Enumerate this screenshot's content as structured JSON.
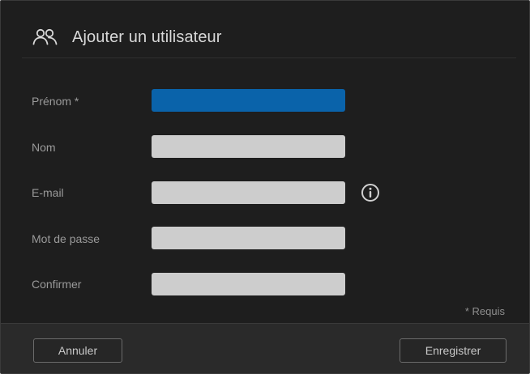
{
  "dialog": {
    "title": "Ajouter un utilisateur",
    "title_icon": "users-icon"
  },
  "form": {
    "fields": [
      {
        "label": "Prénom *",
        "value": "",
        "focused": true
      },
      {
        "label": "Nom",
        "value": ""
      },
      {
        "label": "E-mail",
        "value": "",
        "help_icon": "info-icon"
      },
      {
        "label": "Mot de passe",
        "value": ""
      },
      {
        "label": "Confirmer",
        "value": ""
      }
    ],
    "required_note": "* Requis"
  },
  "footer": {
    "cancel_label": "Annuler",
    "save_label": "Enregistrer"
  },
  "colors": {
    "background": "#1e1e1e",
    "footer": "#2a2a2a",
    "input": "#cdcdcd",
    "input_focused": "#0a63aa",
    "label": "#9a9a9a",
    "title": "#d8d8d8"
  }
}
